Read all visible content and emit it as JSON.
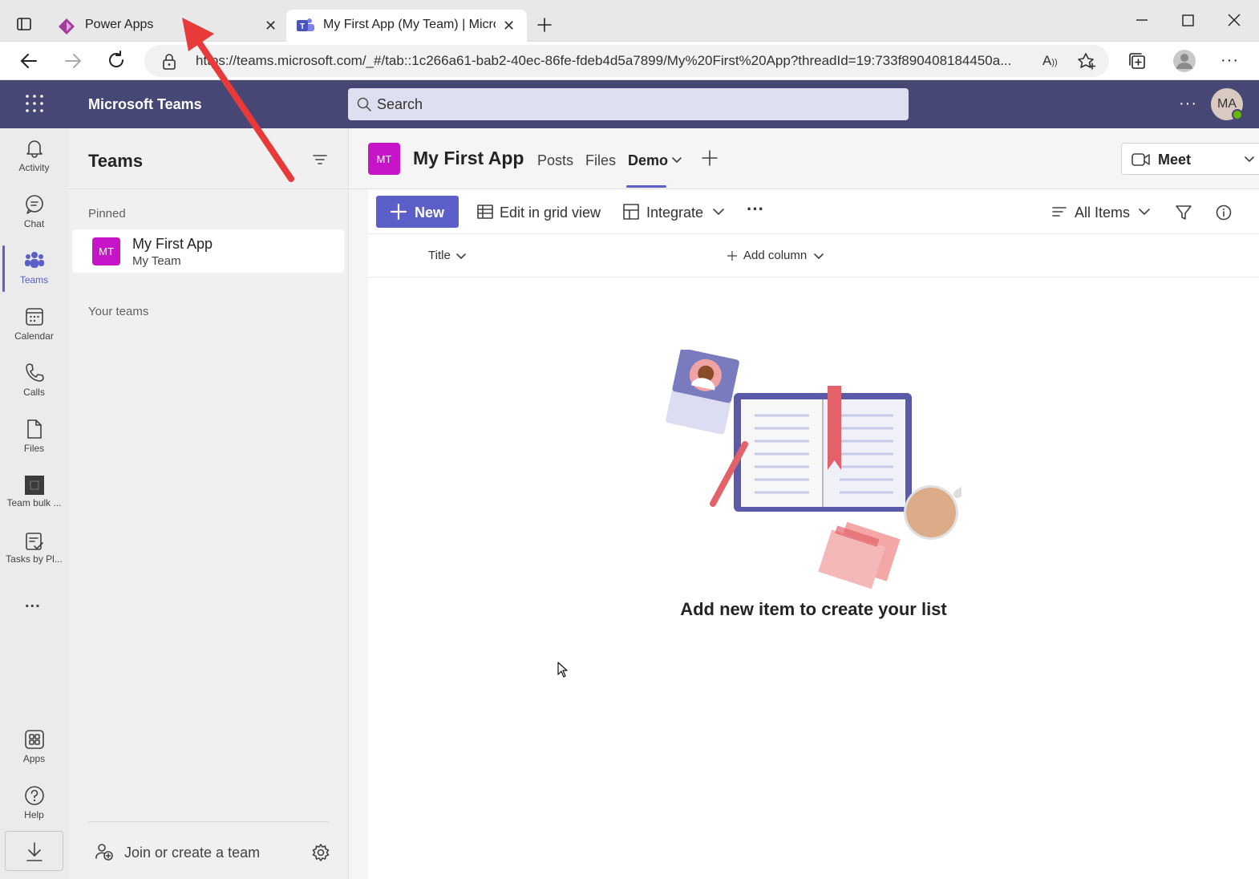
{
  "browser": {
    "tabs": [
      {
        "label": "Power Apps",
        "icon": "power-apps-icon",
        "active": false
      },
      {
        "label": "My First App (My Team) | Microsoft Teams",
        "icon": "teams-icon",
        "active": true
      }
    ],
    "url": "https://teams.microsoft.com/_#/tab::1c266a61-bab2-40ec-86fe-fdeb4d5a7899/My%20First%20App?threadId=19:733f890408184450a..."
  },
  "teams_header": {
    "brand": "Microsoft Teams",
    "search_placeholder": "Search",
    "avatar_initials": "MA"
  },
  "rail": {
    "items": [
      {
        "label": "Activity",
        "icon": "bell-icon"
      },
      {
        "label": "Chat",
        "icon": "chat-icon"
      },
      {
        "label": "Teams",
        "icon": "teams-people-icon",
        "active": true
      },
      {
        "label": "Calendar",
        "icon": "calendar-icon"
      },
      {
        "label": "Calls",
        "icon": "phone-icon"
      },
      {
        "label": "Files",
        "icon": "file-icon"
      },
      {
        "label": "Team bulk ...",
        "icon": "app-tile-icon"
      },
      {
        "label": "Tasks by Pl...",
        "icon": "tasks-icon"
      }
    ],
    "more": "...",
    "apps_label": "Apps",
    "help_label": "Help"
  },
  "teams_panel": {
    "title": "Teams",
    "pinned_label": "Pinned",
    "pinned_item": {
      "initials": "MT",
      "name": "My First App",
      "team": "My Team"
    },
    "your_teams_label": "Your teams",
    "join_label": "Join or create a team"
  },
  "channel": {
    "initials": "MT",
    "title": "My First App",
    "tabs": [
      "Posts",
      "Files",
      "Demo"
    ],
    "active_tab": "Demo",
    "meet_label": "Meet"
  },
  "list": {
    "new_label": "New",
    "edit_grid_label": "Edit in grid view",
    "integrate_label": "Integrate",
    "more_label": "···",
    "view_label": "All Items",
    "columns": [
      "Title",
      "Add column"
    ],
    "empty_message": "Add new item to create your list"
  },
  "colors": {
    "teams_header": "#464775",
    "accent": "#5b5fc7",
    "team_badge": "#c814c8",
    "annotation_arrow": "#e8393b"
  }
}
